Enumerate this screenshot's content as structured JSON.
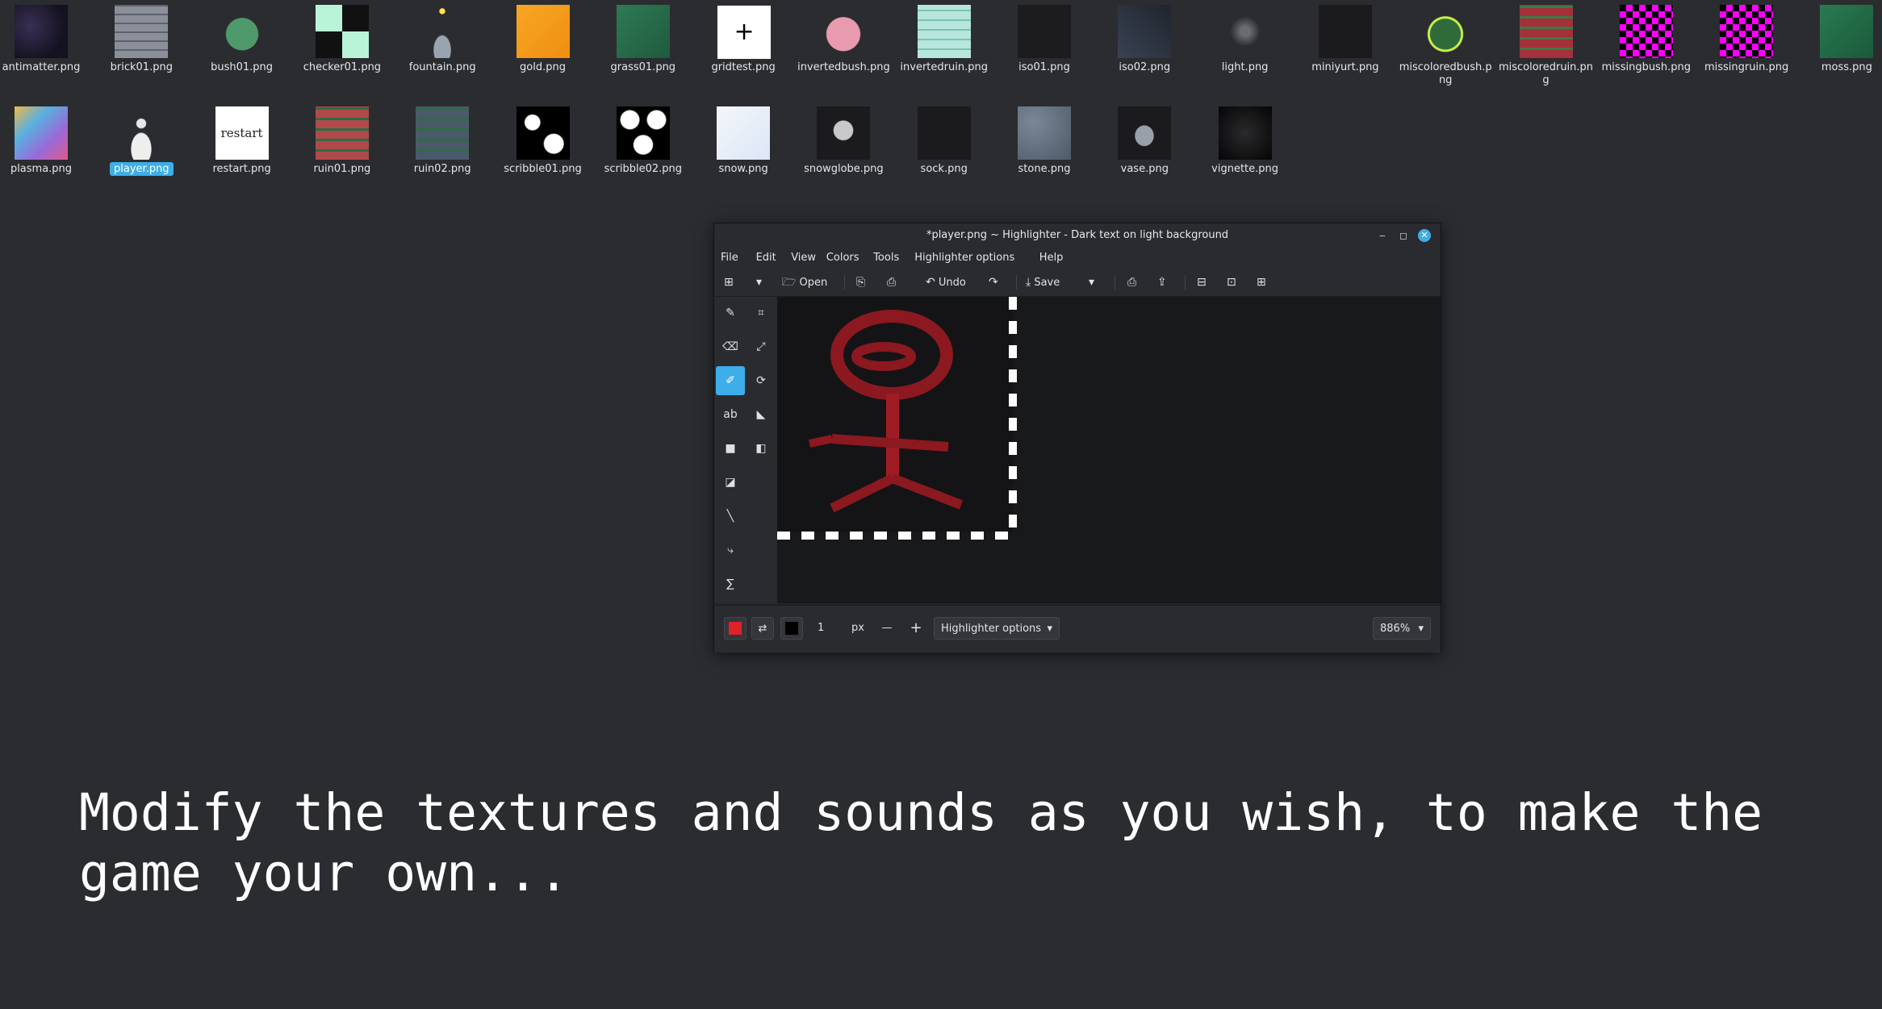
{
  "files_row1": [
    {
      "name": "antimatter.png",
      "icon": "antimatter-thumbnail"
    },
    {
      "name": "brick01.png",
      "icon": "brick-thumbnail"
    },
    {
      "name": "bush01.png",
      "icon": "bush-thumbnail"
    },
    {
      "name": "checker01.png",
      "icon": "checker-thumbnail"
    },
    {
      "name": "fountain.png",
      "icon": "fountain-thumbnail"
    },
    {
      "name": "gold.png",
      "icon": "gold-thumbnail"
    },
    {
      "name": "grass01.png",
      "icon": "grass-thumbnail"
    },
    {
      "name": "gridtest.png",
      "icon": "gridtest-thumbnail"
    },
    {
      "name": "invertedbush.png",
      "icon": "invertedbush-thumbnail"
    },
    {
      "name": "invertedruin.png",
      "icon": "invertedruin-thumbnail"
    },
    {
      "name": "iso01.png",
      "icon": "iso01-thumbnail"
    },
    {
      "name": "iso02.png",
      "icon": "iso02-thumbnail"
    },
    {
      "name": "light.png",
      "icon": "light-thumbnail"
    },
    {
      "name": "miniyurt.png",
      "icon": "miniyurt-thumbnail"
    },
    {
      "name": "miscoloredbush.png",
      "icon": "miscoloredbush-thumbnail"
    },
    {
      "name": "miscoloredruin.png",
      "icon": "miscoloredruin-thumbnail"
    },
    {
      "name": "missingbush.png",
      "icon": "missingbush-thumbnail"
    },
    {
      "name": "missingruin.png",
      "icon": "missingruin-thumbnail"
    },
    {
      "name": "moss.png",
      "icon": "moss-thumbnail"
    }
  ],
  "files_row2": [
    {
      "name": "plasma.png",
      "icon": "plasma-thumbnail"
    },
    {
      "name": "player.png",
      "icon": "player-thumbnail",
      "selected": true
    },
    {
      "name": "restart.png",
      "icon": "restart-thumbnail",
      "thumb_text": "restart"
    },
    {
      "name": "ruin01.png",
      "icon": "ruin01-thumbnail"
    },
    {
      "name": "ruin02.png",
      "icon": "ruin02-thumbnail"
    },
    {
      "name": "scribble01.png",
      "icon": "scribble01-thumbnail"
    },
    {
      "name": "scribble02.png",
      "icon": "scribble02-thumbnail"
    },
    {
      "name": "snow.png",
      "icon": "snow-thumbnail"
    },
    {
      "name": "snowglobe.png",
      "icon": "snowglobe-thumbnail"
    },
    {
      "name": "sock.png",
      "icon": "sock-thumbnail"
    },
    {
      "name": "stone.png",
      "icon": "stone-thumbnail"
    },
    {
      "name": "vase.png",
      "icon": "vase-thumbnail"
    },
    {
      "name": "vignette.png",
      "icon": "vignette-thumbnail"
    }
  ],
  "window": {
    "title": "*player.png ~ Highlighter - Dark text on light background",
    "minimize_icon": "minimize-icon",
    "maximize_icon": "maximize-icon",
    "close_icon": "close-icon"
  },
  "menu": [
    "File",
    "Edit",
    "View",
    "Colors",
    "Tools",
    "Highlighter options",
    "Help"
  ],
  "toolbar": {
    "new_icon": "new-image-icon",
    "open_label": "Open",
    "undo_label": "Undo",
    "save_label": "Save"
  },
  "tools": [
    {
      "name": "pencil-icon",
      "glyph": "✎"
    },
    {
      "name": "crop-icon",
      "glyph": "⌗"
    },
    {
      "name": "eraser-icon",
      "glyph": "⌫"
    },
    {
      "name": "scale-icon",
      "glyph": "⤢"
    },
    {
      "name": "highlighter-icon",
      "glyph": "✐",
      "active": true
    },
    {
      "name": "rotate-icon",
      "glyph": "⟳"
    },
    {
      "name": "text-icon",
      "glyph": "ab"
    },
    {
      "name": "paint-bucket-icon",
      "glyph": "◣"
    },
    {
      "name": "rectangle-icon",
      "glyph": "■"
    },
    {
      "name": "color-picker-icon",
      "glyph": "◧"
    },
    {
      "name": "selection-icon",
      "glyph": "◪"
    },
    {
      "name": "line-icon",
      "glyph": "╲"
    },
    {
      "name": "curve-icon",
      "glyph": "⤷"
    },
    {
      "name": "freeform-icon",
      "glyph": "∑"
    }
  ],
  "bottombar": {
    "primary_color": "#e0222b",
    "secondary_color": "#000000",
    "size_value": "1",
    "size_unit": "px",
    "minus_label": "—",
    "plus_label": "+",
    "options_label": "Highlighter options",
    "zoom_label": "886%"
  },
  "caption": "Modify the textures and sounds as you wish, to make the\ngame your own..."
}
